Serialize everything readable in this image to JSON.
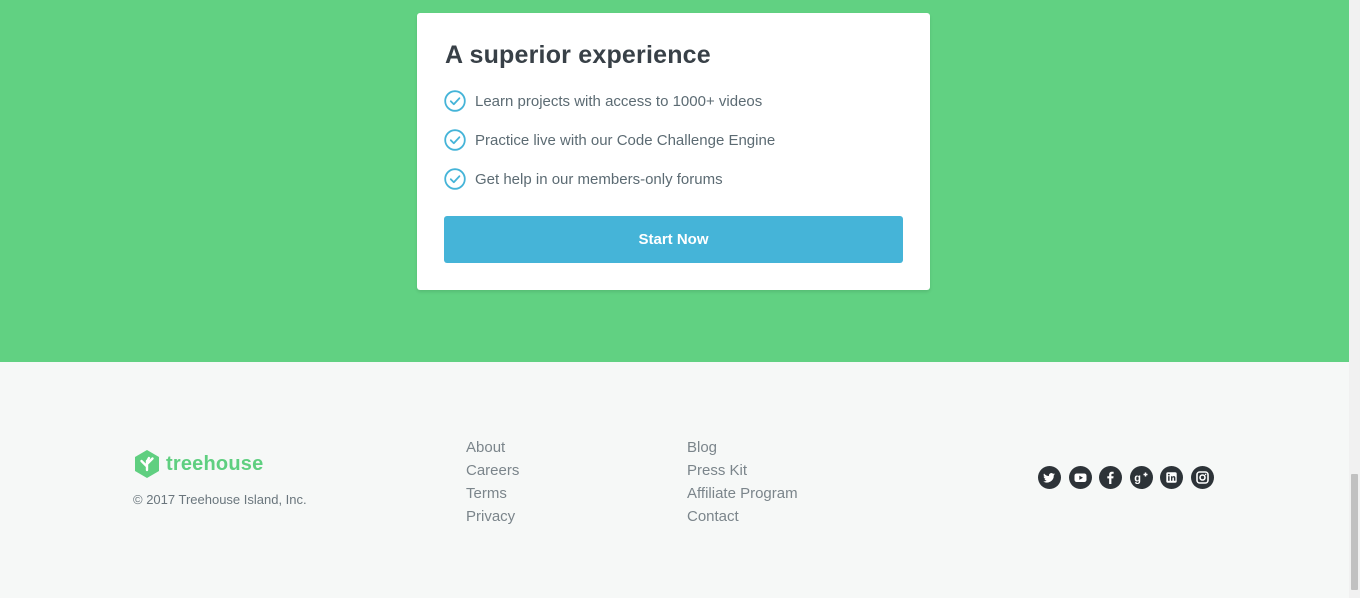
{
  "card": {
    "title": "A superior experience",
    "features": [
      "Learn projects with access to 1000+ videos",
      "Practice live with our Code Challenge Engine",
      "Get help in our members-only forums"
    ],
    "cta_label": "Start Now"
  },
  "footer": {
    "brand": "treehouse",
    "copyright": "© 2017 Treehouse Island, Inc.",
    "links_col1": [
      "About",
      "Careers",
      "Terms",
      "Privacy"
    ],
    "links_col2": [
      "Blog",
      "Press Kit",
      "Affiliate Program",
      "Contact"
    ],
    "social_icons": [
      "twitter-icon",
      "youtube-icon",
      "facebook-icon",
      "google-plus-icon",
      "linkedin-icon",
      "instagram-icon"
    ]
  },
  "colors": {
    "hero_bg": "#61d182",
    "brand_green": "#5fcf80",
    "cta_blue": "#45b4d8",
    "check_blue": "#45b4d8",
    "footer_bg": "#f6f8f7",
    "heading": "#384047"
  }
}
